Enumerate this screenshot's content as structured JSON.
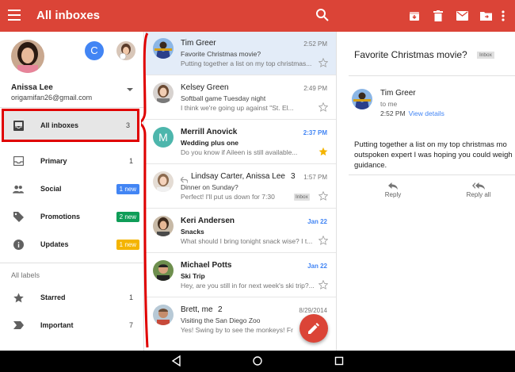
{
  "appbar": {
    "title": "All inboxes",
    "color": "#db4437",
    "icons": [
      "menu-icon",
      "search-icon",
      "archive-icon",
      "delete-icon",
      "mail-icon",
      "move-to-folder-icon",
      "more-vert-icon"
    ]
  },
  "account": {
    "name": "Anissa Lee",
    "email": "origamifan26@gmail.com",
    "second_account_initial": "C"
  },
  "nav": {
    "all_inboxes": {
      "label": "All inboxes",
      "count": "3"
    },
    "primary": {
      "label": "Primary",
      "count": "1"
    },
    "social": {
      "label": "Social",
      "badge": "1 new",
      "badge_color": "#4285f4"
    },
    "promotions": {
      "label": "Promotions",
      "badge": "2 new",
      "badge_color": "#0f9d58"
    },
    "updates": {
      "label": "Updates",
      "badge": "1 new",
      "badge_color": "#f4b400"
    },
    "all_labels": "All labels",
    "starred": {
      "label": "Starred",
      "count": "1"
    },
    "important": {
      "label": "Important",
      "count": "7"
    }
  },
  "emails": [
    {
      "sender": "Tim Greer",
      "time": "2:52 PM",
      "subject": "Favorite Christmas movie?",
      "snippet": "Putting together a list on my top christmas...",
      "unread": false,
      "starred": false,
      "selected": true
    },
    {
      "sender": "Kelsey Green",
      "time": "2:49 PM",
      "subject": "Softball game Tuesday night",
      "snippet": "I think we're going up against \"St. El...",
      "unread": false,
      "starred": false
    },
    {
      "sender": "Merrill Anovick",
      "time": "2:37 PM",
      "subject": "Wedding plus one",
      "snippet": "Do you know if Aileen is still available...",
      "unread": true,
      "starred": true,
      "avatar_letter": "M"
    },
    {
      "sender": "Lindsay Carter, Anissa Lee",
      "count": "3",
      "time": "1:57 PM",
      "subject": "Dinner on Sunday?",
      "snippet": "Perfect! I'll put us down for 7:30",
      "unread": false,
      "starred": false,
      "label": "Inbox"
    },
    {
      "sender": "Keri Andersen",
      "time": "Jan 22",
      "subject": "Snacks",
      "snippet": "What should I bring tonight snack wise? I t...",
      "unread": true,
      "starred": false
    },
    {
      "sender": "Michael Potts",
      "time": "Jan 22",
      "subject": "Ski Trip",
      "snippet": "Hey, are you still in for next week's ski trip?...",
      "unread": true,
      "starred": false
    },
    {
      "sender": "Brett, me",
      "count": "2",
      "time": "8/29/2014",
      "subject": "Visiting the San Diego Zoo",
      "snippet": "Yes! Swing by to see the monkeys! Fr",
      "unread": false,
      "starred": false
    }
  ],
  "reading": {
    "subject": "Favorite Christmas movie?",
    "label": "Inbox",
    "from": "Tim Greer",
    "to": "to me",
    "time": "2:52 PM",
    "view_details": "View details",
    "body_lines": [
      "Putting together a list on my top christmas mo",
      "outspoken expert I was hoping you could weigh",
      "guidance."
    ],
    "reply": "Reply",
    "reply_all": "Reply all"
  },
  "system_nav": {
    "icons": [
      "back-icon",
      "home-icon",
      "recents-icon"
    ]
  }
}
